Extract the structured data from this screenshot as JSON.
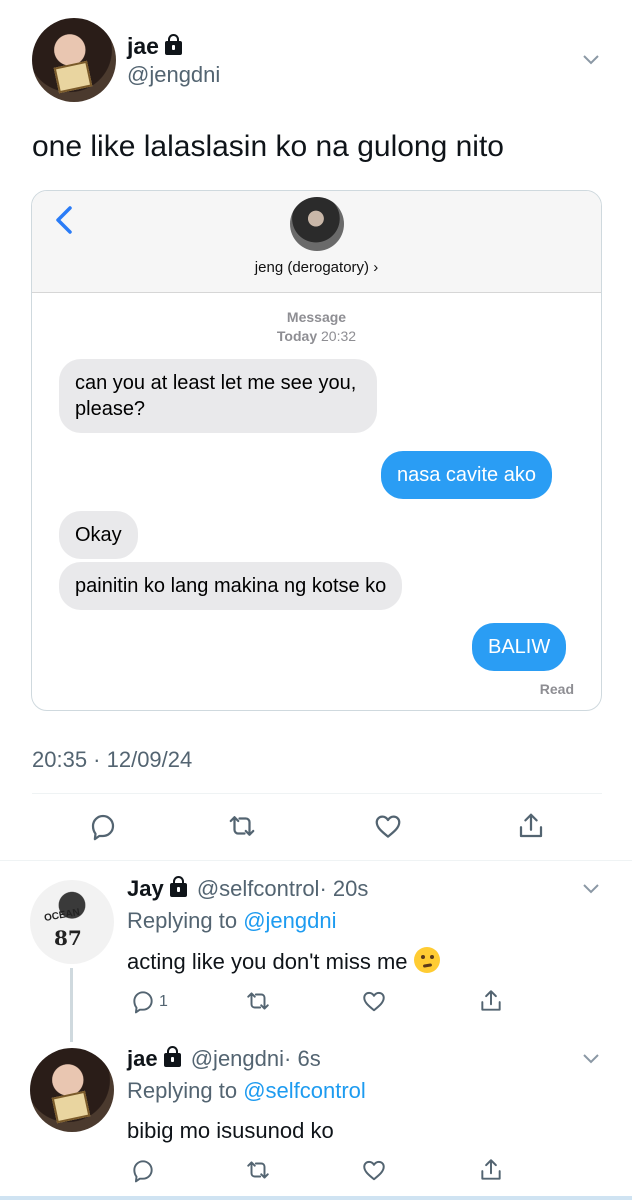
{
  "main_tweet": {
    "display_name": "jae",
    "handle": "@jengdni",
    "text": "one like lalaslasin ko na gulong nito",
    "timestamp": "20:35 · 12/09/24"
  },
  "imessage": {
    "contact_name": "jeng (derogatory) ›",
    "header_label": "Message",
    "day_label": "Today",
    "time_label": "20:32",
    "messages": [
      {
        "direction": "in",
        "text": "can you at least let me see you, please?"
      },
      {
        "direction": "out",
        "text": "nasa cavite ako"
      },
      {
        "direction": "in",
        "text": "Okay"
      },
      {
        "direction": "in",
        "text": "painitin ko lang makina ng kotse ko"
      },
      {
        "direction": "out",
        "text": "BALIW"
      }
    ],
    "read_receipt": "Read"
  },
  "replies": [
    {
      "display_name": "Jay",
      "handle": "@selfcontrol",
      "age": "· 20s",
      "replying_prefix": "Replying to",
      "replying_to": "@jengdni",
      "text": "acting like you don't miss me",
      "reply_count": "1",
      "avatar_lettering": {
        "name": "OCEAN",
        "number": "87"
      }
    },
    {
      "display_name": "jae",
      "handle": "@jengdni",
      "age": "· 6s",
      "replying_prefix": "Replying to",
      "replying_to": "@selfcontrol",
      "text": "bibig mo isusunod ko"
    }
  ],
  "colors": {
    "accent": "#1d9bf0",
    "imessage_blue": "#2a9df4",
    "imessage_gray": "#e9e9eb",
    "muted_text": "#536471"
  },
  "icons": [
    "lock-icon",
    "chevron-down-icon",
    "reply-icon",
    "retweet-icon",
    "like-icon",
    "share-icon",
    "back-chevron-icon",
    "grimace-emoji"
  ]
}
